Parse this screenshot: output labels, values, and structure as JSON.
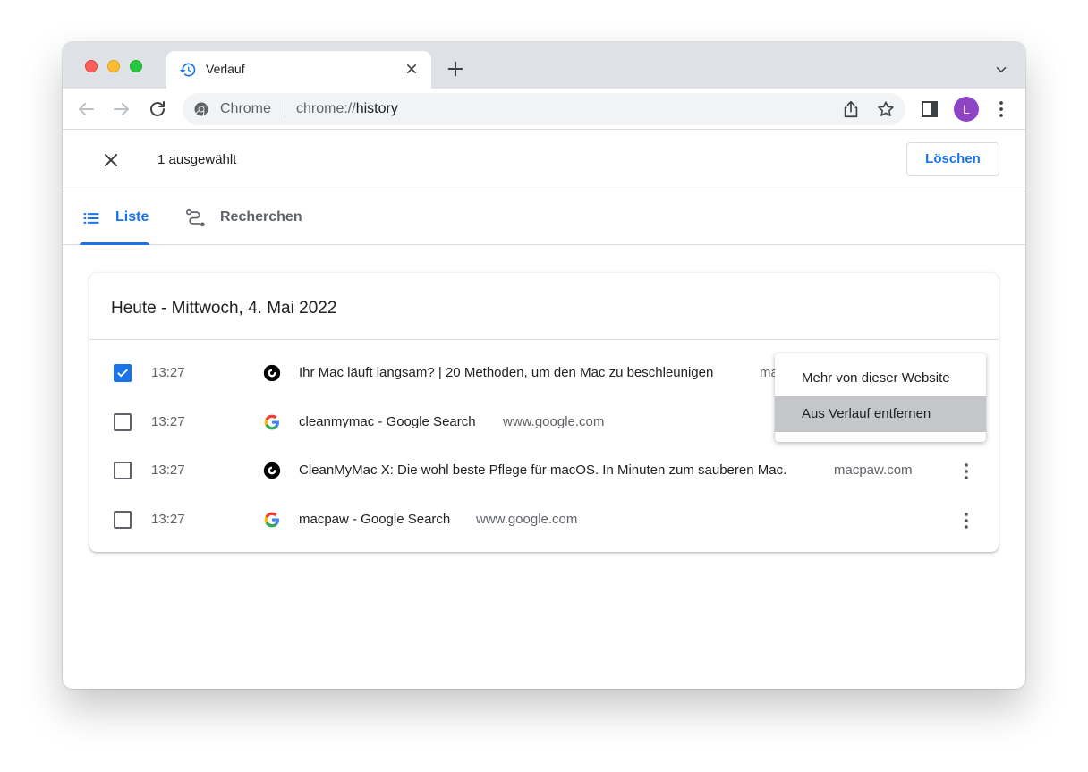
{
  "browser": {
    "tab": {
      "title": "Verlauf"
    },
    "omnibox": {
      "label": "Chrome",
      "url_scheme": "chrome://",
      "url_host": "history"
    },
    "profile_initial": "L",
    "accent_color": "#1a73e8",
    "avatar_color": "#8e44c4"
  },
  "selection_bar": {
    "count_text": "1 ausgewählt",
    "delete_label": "Löschen"
  },
  "nav_tabs": [
    {
      "label": "Liste",
      "icon": "list-icon",
      "active": true
    },
    {
      "label": "Recherchen",
      "icon": "journeys-icon",
      "active": false
    }
  ],
  "history": {
    "date_heading": "Heute - Mittwoch, 4. Mai 2022",
    "entries": [
      {
        "time": "13:27",
        "title": "Ihr Mac läuft langsam? | 20 Methoden, um den Mac zu beschleunigen",
        "domain": "macpaw.com",
        "favicon": "macpaw-icon",
        "checked": true
      },
      {
        "time": "13:27",
        "title": "cleanmymac - Google Search",
        "domain": "www.google.com",
        "favicon": "google-icon",
        "checked": false
      },
      {
        "time": "13:27",
        "title": "CleanMyMac X: Die wohl beste Pflege für macOS. In Minuten zum sauberen Mac.",
        "domain": "macpaw.com",
        "favicon": "macpaw-icon",
        "checked": false
      },
      {
        "time": "13:27",
        "title": "macpaw - Google Search",
        "domain": "www.google.com",
        "favicon": "google-icon",
        "checked": false
      }
    ]
  },
  "context_menu": {
    "items": [
      {
        "label": "Mehr von dieser Website",
        "highlighted": false
      },
      {
        "label": "Aus Verlauf entfernen",
        "highlighted": true
      }
    ]
  }
}
